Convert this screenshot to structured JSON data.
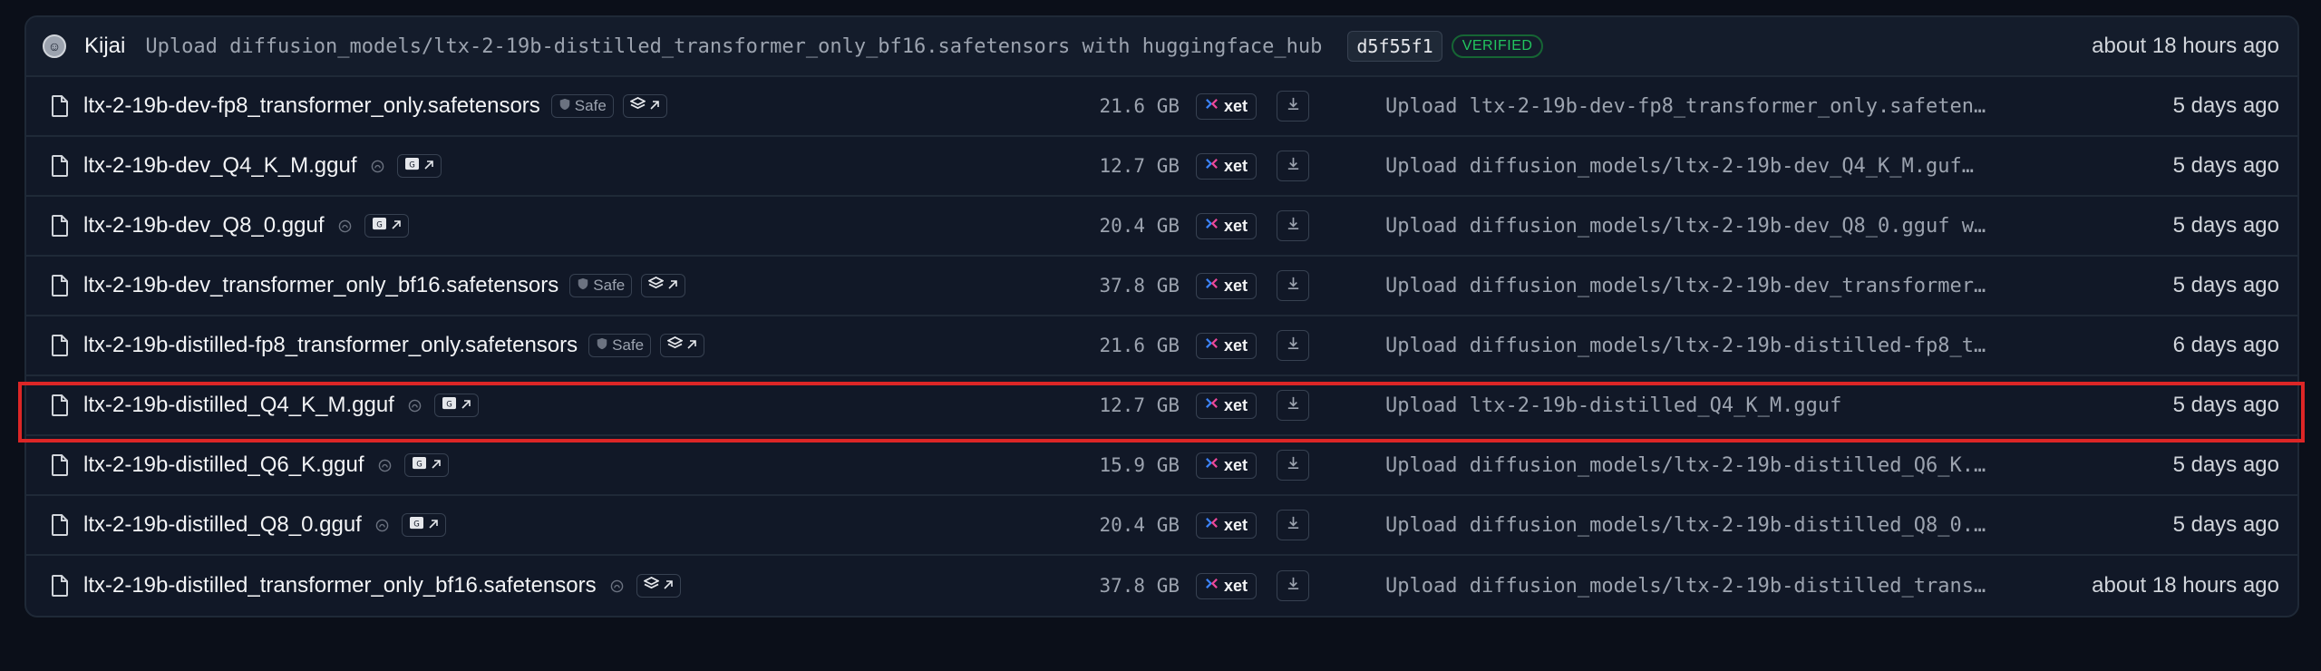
{
  "commit": {
    "author": "Kijai",
    "message": "Upload diffusion_models/ltx-2-19b-distilled_transformer_only_bf16.safetensors with huggingface_hub",
    "hash": "d5f55f1",
    "verified": "VERIFIED",
    "time": "about 18 hours ago"
  },
  "badges": {
    "safe": "Safe",
    "xet": "xet"
  },
  "files": [
    {
      "name": "ltx-2-19b-dev-fp8_transformer_only.safetensors",
      "safe": true,
      "viewer_icon": "layers-icon",
      "size": "21.6 GB",
      "message": "Upload ltx-2-19b-dev-fp8_transformer_only.safeten…",
      "time": "5 days ago"
    },
    {
      "name": "ltx-2-19b-dev_Q4_K_M.gguf",
      "safe": false,
      "viewer_icon": "gguf-icon",
      "size": "12.7 GB",
      "message": "Upload diffusion_models/ltx-2-19b-dev_Q4_K_M.guf…",
      "time": "5 days ago"
    },
    {
      "name": "ltx-2-19b-dev_Q8_0.gguf",
      "safe": false,
      "viewer_icon": "gguf-icon",
      "size": "20.4 GB",
      "message": "Upload diffusion_models/ltx-2-19b-dev_Q8_0.gguf w…",
      "time": "5 days ago"
    },
    {
      "name": "ltx-2-19b-dev_transformer_only_bf16.safetensors",
      "safe": true,
      "viewer_icon": "layers-icon",
      "size": "37.8 GB",
      "message": "Upload diffusion_models/ltx-2-19b-dev_transformer…",
      "time": "5 days ago"
    },
    {
      "name": "ltx-2-19b-distilled-fp8_transformer_only.safetensors",
      "safe": true,
      "viewer_icon": "layers-icon",
      "size": "21.6 GB",
      "message": "Upload diffusion_models/ltx-2-19b-distilled-fp8_t…",
      "time": "6 days ago"
    },
    {
      "name": "ltx-2-19b-distilled_Q4_K_M.gguf",
      "safe": false,
      "viewer_icon": "gguf-icon",
      "size": "12.7 GB",
      "message": "Upload ltx-2-19b-distilled_Q4_K_M.gguf",
      "time": "5 days ago"
    },
    {
      "name": "ltx-2-19b-distilled_Q6_K.gguf",
      "safe": false,
      "viewer_icon": "gguf-icon",
      "size": "15.9 GB",
      "message": "Upload diffusion_models/ltx-2-19b-distilled_Q6_K.…",
      "time": "5 days ago"
    },
    {
      "name": "ltx-2-19b-distilled_Q8_0.gguf",
      "safe": false,
      "viewer_icon": "gguf-icon",
      "size": "20.4 GB",
      "message": "Upload diffusion_models/ltx-2-19b-distilled_Q8_0.…",
      "time": "5 days ago"
    },
    {
      "name": "ltx-2-19b-distilled_transformer_only_bf16.safetensors",
      "safe": false,
      "viewer_icon": "layers-icon",
      "size": "37.8 GB",
      "message": "Upload diffusion_models/ltx-2-19b-distilled_trans…",
      "time": "about 18 hours ago"
    }
  ],
  "highlighted_file": "ltx-2-19b-distilled_Q4_K_M.gguf",
  "colors": {
    "highlight": "#dc2626",
    "verified": "#22c55e",
    "xet_accent": "#3b82f6",
    "xet_accent2": "#ec4899"
  }
}
